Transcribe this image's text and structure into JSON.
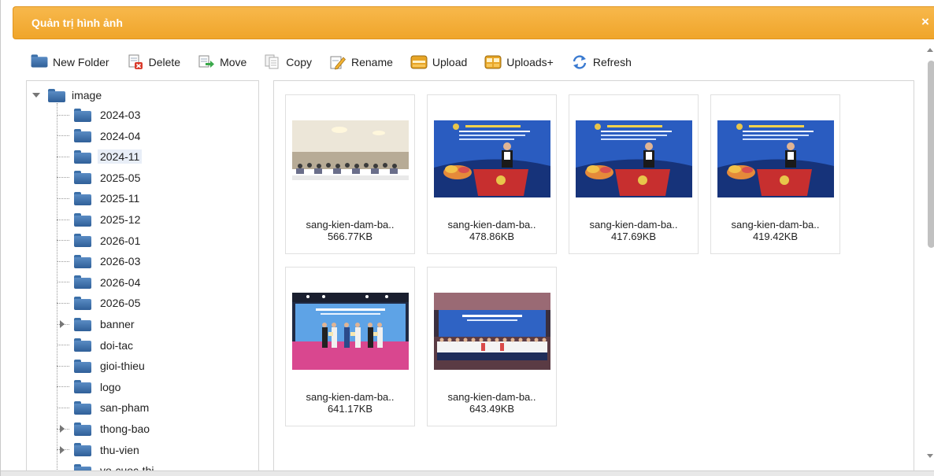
{
  "window": {
    "title": "Quản trị hình ảnh",
    "close_glyph": "×"
  },
  "toolbar": [
    {
      "label": "New Folder",
      "icon": "folder-icon"
    },
    {
      "label": "Delete",
      "icon": "delete-icon"
    },
    {
      "label": "Move",
      "icon": "move-icon"
    },
    {
      "label": "Copy",
      "icon": "copy-icon"
    },
    {
      "label": "Rename",
      "icon": "rename-icon"
    },
    {
      "label": "Upload",
      "icon": "upload-icon"
    },
    {
      "label": "Uploads+",
      "icon": "uploads-plus-icon"
    },
    {
      "label": "Refresh",
      "icon": "refresh-icon"
    }
  ],
  "tree": {
    "root": "image",
    "items": [
      {
        "label": "2024-03",
        "expandable": false,
        "selected": false
      },
      {
        "label": "2024-04",
        "expandable": false,
        "selected": false
      },
      {
        "label": "2024-11",
        "expandable": false,
        "selected": true
      },
      {
        "label": "2025-05",
        "expandable": false,
        "selected": false
      },
      {
        "label": "2025-11",
        "expandable": false,
        "selected": false
      },
      {
        "label": "2025-12",
        "expandable": false,
        "selected": false
      },
      {
        "label": "2026-01",
        "expandable": false,
        "selected": false
      },
      {
        "label": "2026-03",
        "expandable": false,
        "selected": false
      },
      {
        "label": "2026-04",
        "expandable": false,
        "selected": false
      },
      {
        "label": "2026-05",
        "expandable": false,
        "selected": false
      },
      {
        "label": "banner",
        "expandable": true,
        "selected": false
      },
      {
        "label": "doi-tac",
        "expandable": false,
        "selected": false
      },
      {
        "label": "gioi-thieu",
        "expandable": false,
        "selected": false
      },
      {
        "label": "logo",
        "expandable": false,
        "selected": false
      },
      {
        "label": "san-pham",
        "expandable": false,
        "selected": false
      },
      {
        "label": "thong-bao",
        "expandable": true,
        "selected": false
      },
      {
        "label": "thu-vien",
        "expandable": true,
        "selected": false
      },
      {
        "label": "vo-cuoc-thi",
        "expandable": false,
        "selected": false
      }
    ]
  },
  "files": [
    {
      "name": "sang-kien-dam-ba..",
      "size": "566.77KB",
      "scene": "conference-hall"
    },
    {
      "name": "sang-kien-dam-ba..",
      "size": "478.86KB",
      "scene": "podium-speaker"
    },
    {
      "name": "sang-kien-dam-ba..",
      "size": "417.69KB",
      "scene": "podium-speaker"
    },
    {
      "name": "sang-kien-dam-ba..",
      "size": "419.42KB",
      "scene": "podium-speaker"
    },
    {
      "name": "sang-kien-dam-ba..",
      "size": "641.17KB",
      "scene": "award-stage"
    },
    {
      "name": "sang-kien-dam-ba..",
      "size": "643.49KB",
      "scene": "group-stage"
    }
  ],
  "colors": {
    "titlebar": "#f0a52a",
    "folder": "#3b6fa8",
    "selection": "#e8eef7"
  }
}
